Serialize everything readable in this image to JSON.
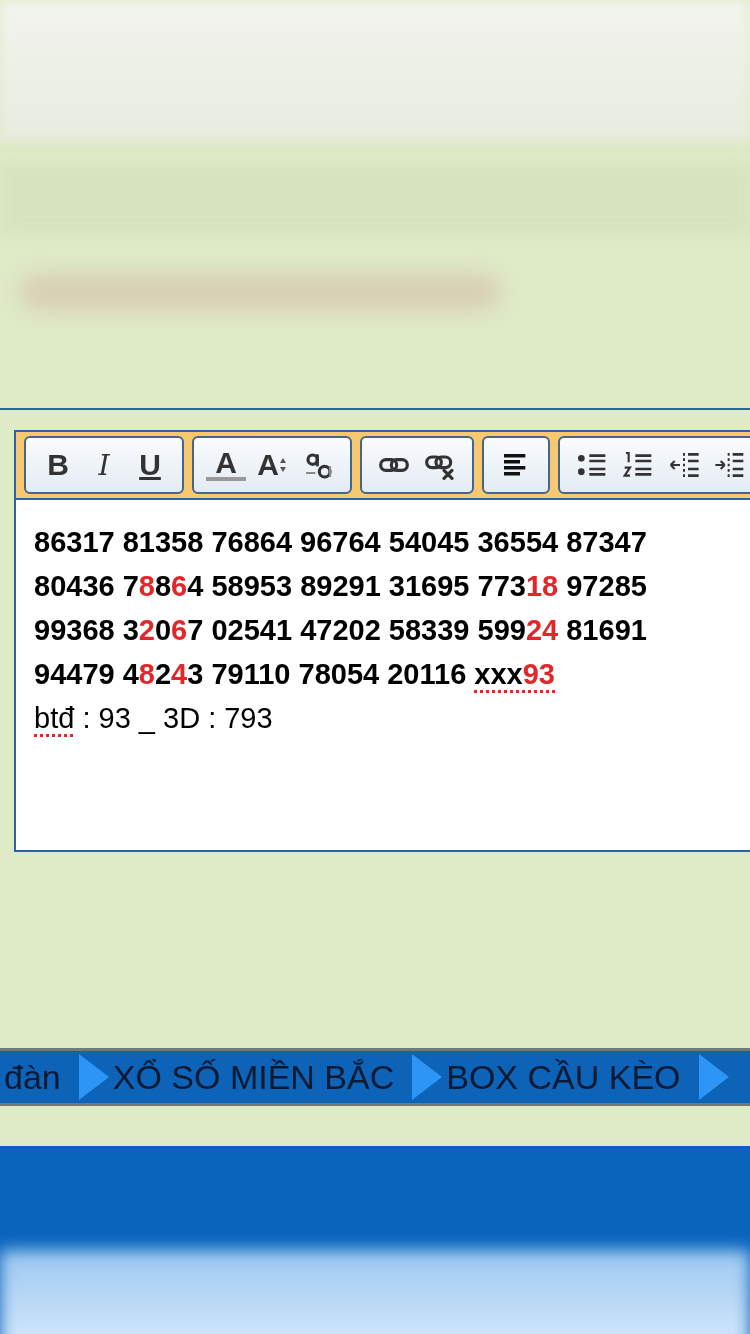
{
  "toolbar": {
    "groups": [
      [
        {
          "kind": "bold",
          "label": "B"
        },
        {
          "kind": "italic",
          "label": "I"
        },
        {
          "kind": "underline",
          "label": "U"
        }
      ],
      [
        {
          "kind": "font-color",
          "label": "A"
        },
        {
          "kind": "font-size",
          "label": "A"
        },
        {
          "kind": "subscript"
        }
      ],
      [
        {
          "kind": "link"
        },
        {
          "kind": "unlink"
        }
      ],
      [
        {
          "kind": "align-left"
        }
      ],
      [
        {
          "kind": "bullet-list"
        },
        {
          "kind": "numbered-list"
        },
        {
          "kind": "outdent"
        },
        {
          "kind": "indent"
        }
      ]
    ]
  },
  "editor": {
    "lines": [
      {
        "bold": true,
        "parts": [
          {
            "text": "86317 81358 76864 96764 54045 36554 87347",
            "highlight": false
          }
        ]
      },
      {
        "bold": true,
        "parts": [
          {
            "text": "80436 7",
            "highlight": false
          },
          {
            "text": "8",
            "highlight": true
          },
          {
            "text": "8",
            "highlight": false
          },
          {
            "text": "6",
            "highlight": true
          },
          {
            "text": "4 58953 89291 31695 773",
            "highlight": false
          },
          {
            "text": "18",
            "highlight": true
          },
          {
            "text": " 97285",
            "highlight": false
          }
        ]
      },
      {
        "bold": true,
        "parts": [
          {
            "text": "99368 3",
            "highlight": false
          },
          {
            "text": "2",
            "highlight": true
          },
          {
            "text": "0",
            "highlight": false
          },
          {
            "text": "6",
            "highlight": true
          },
          {
            "text": "7 02541 47202 58339 599",
            "highlight": false
          },
          {
            "text": "24",
            "highlight": true
          },
          {
            "text": " 81691",
            "highlight": false
          }
        ]
      },
      {
        "bold": true,
        "parts": [
          {
            "text": "94479 4",
            "highlight": false
          },
          {
            "text": "8",
            "highlight": true
          },
          {
            "text": "2",
            "highlight": false
          },
          {
            "text": "4",
            "highlight": true
          },
          {
            "text": "3 79110 78054 20116 ",
            "highlight": false
          },
          {
            "text": "xxx",
            "highlight": false,
            "misspelled": true
          },
          {
            "text": "93",
            "highlight": true,
            "misspelled": true
          }
        ]
      },
      {
        "bold": false,
        "parts": [
          {
            "text": "btđ",
            "highlight": false,
            "misspelled": true
          },
          {
            "text": " : 93 _ 3D : 793",
            "highlight": false
          }
        ]
      }
    ]
  },
  "breadcrumb": {
    "items": [
      {
        "label": "đàn"
      },
      {
        "label": "XỔ SỐ MIỀN BẮC"
      },
      {
        "label": "BOX CẦU KÈO"
      }
    ]
  }
}
